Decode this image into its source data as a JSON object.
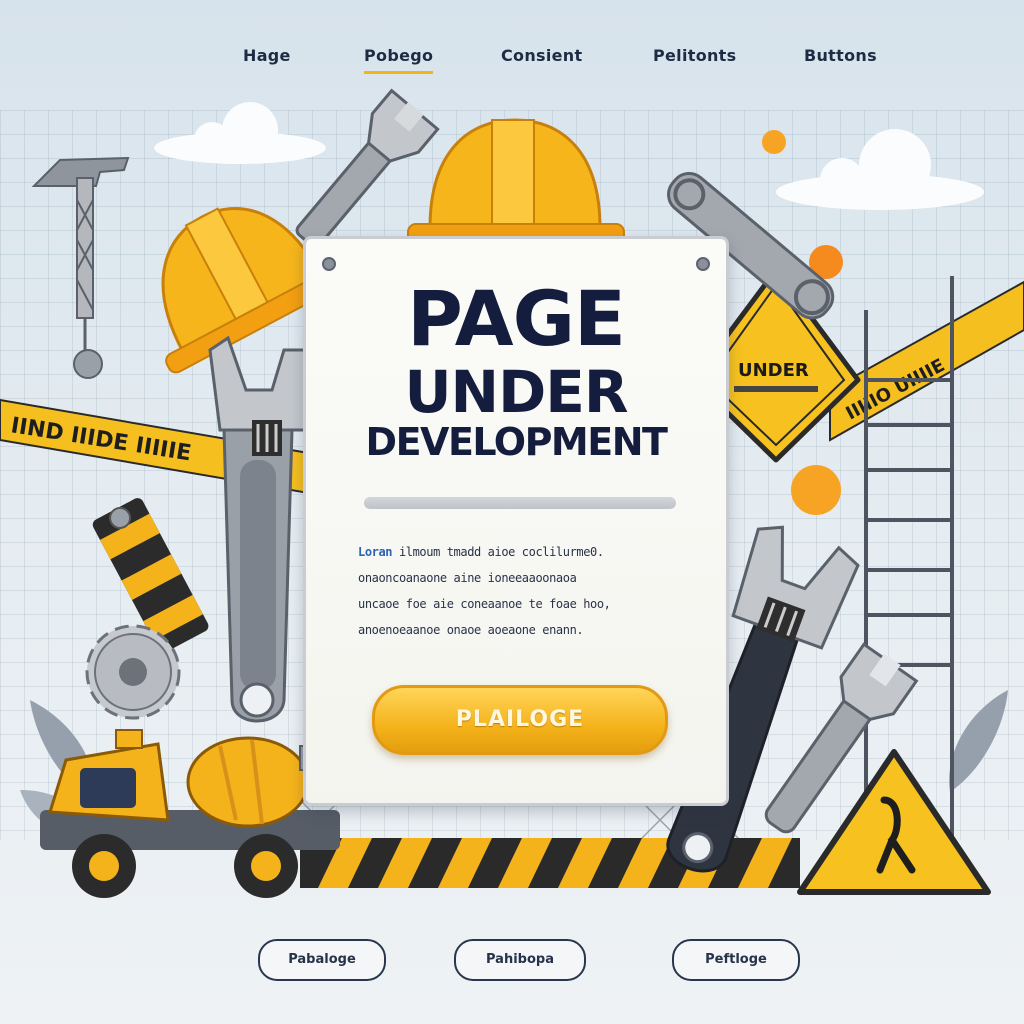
{
  "nav": {
    "items": [
      {
        "label": "Hage",
        "active": false
      },
      {
        "label": "Pobego",
        "active": true
      },
      {
        "label": "Consient",
        "active": false
      },
      {
        "label": "Pelitonts",
        "active": false
      },
      {
        "label": "Buttons",
        "active": false
      }
    ]
  },
  "card": {
    "title_line1": "PAGE",
    "title_line2": "UNDER",
    "title_line3": "DEVELOPMENT",
    "body_lead": "Loran",
    "body_line1": " ilmoum tmadd aioe coclilurme0.",
    "body_line2": "onaoncoanaone aine ioneeaaoonaoa",
    "body_line3": "uncaoe foe aie coneaanoe te foae hoo,",
    "body_line4": "anoenoeaanoe onaoe aoeaone enann.",
    "button_label": "PLAILOGE"
  },
  "signs": {
    "diamond_text": "UNDER",
    "tape_left": "IIND  IIIDE  IIIIIE",
    "tape_right": "IIIIIO  UIIIIE"
  },
  "footer": {
    "pills": [
      "Pabaloge",
      "Pahibopa",
      "Peftloge"
    ]
  },
  "colors": {
    "accent_yellow": "#f5b31b",
    "navy": "#141d3d",
    "steel": "#8b9099"
  }
}
